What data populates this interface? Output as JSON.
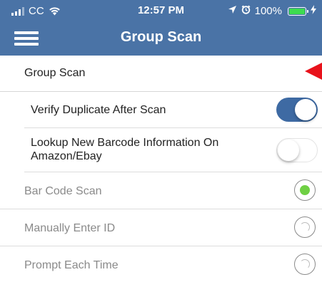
{
  "status_bar": {
    "carrier": "CC",
    "time": "12:57 PM",
    "battery": "100%",
    "battery_level": 1.0,
    "colors": {
      "battery_fill": "#3ddc4f",
      "bar_bg": "#4a73a6"
    }
  },
  "nav": {
    "title": "Group Scan",
    "menu_icon": "hamburger-menu-icon"
  },
  "section": {
    "label": "Group Scan"
  },
  "toggles": [
    {
      "label": "Verify Duplicate After Scan",
      "on": true
    },
    {
      "label": "Lookup New Barcode Information On Amazon/Ebay",
      "on": false
    }
  ],
  "scan_options": [
    {
      "label": "Bar Code Scan",
      "selected": true
    },
    {
      "label": "Manually Enter ID",
      "selected": false
    },
    {
      "label": "Prompt Each Time",
      "selected": false
    }
  ],
  "colors": {
    "accent": "#3e6aa3",
    "radio_selected": "#6fd044",
    "pointer": "#e8121b"
  }
}
